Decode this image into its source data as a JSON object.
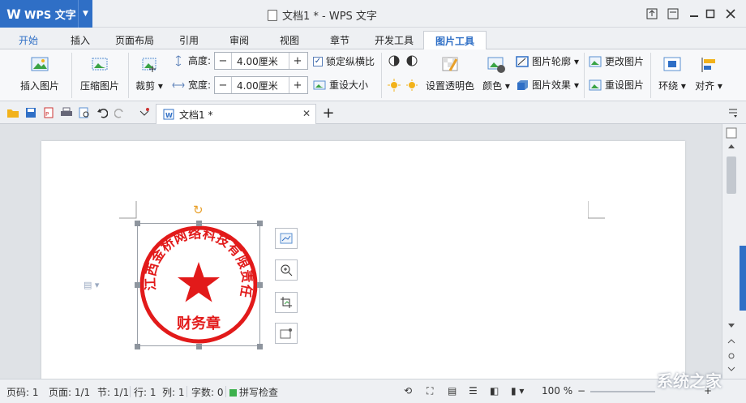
{
  "app": {
    "name": "WPS 文字",
    "logo": "W",
    "window_title": "文档1 * - WPS 文字"
  },
  "menu_tabs": [
    "开始",
    "插入",
    "页面布局",
    "引用",
    "审阅",
    "视图",
    "章节",
    "开发工具",
    "图片工具"
  ],
  "active_tab": "图片工具",
  "ribbon": {
    "insert_picture": "插入图片",
    "compress_picture": "压缩图片",
    "crop": "裁剪",
    "height_label": "高度:",
    "height_value": "4.00厘米",
    "width_label": "宽度:",
    "width_value": "4.00厘米",
    "lock_ratio": "锁定纵横比",
    "reset_size": "重设大小",
    "set_transparent": "设置透明色",
    "color": "颜色",
    "picture_outline": "图片轮廓",
    "picture_effect": "图片效果",
    "change_picture": "更改图片",
    "reset_picture": "重设图片",
    "wrap": "环绕",
    "align": "对齐"
  },
  "doc_tab": {
    "name": "文档1 *"
  },
  "seal": {
    "company": "江西金桥网络科技有限责任公司",
    "bottom_text": "财务章",
    "color": "#e21a1a"
  },
  "status": {
    "page_code": "页码: 1",
    "page": "页面: 1/1",
    "section": "节: 1/1",
    "row": "行: 1",
    "col": "列: 1",
    "word_count": "字数: 0",
    "spell_check": "拼写检查",
    "zoom": "100 %"
  },
  "watermark": "系统之家",
  "colors": {
    "accent": "#2f6fc6",
    "seal_red": "#e21a1a",
    "handle_orange": "#e8a02a"
  }
}
